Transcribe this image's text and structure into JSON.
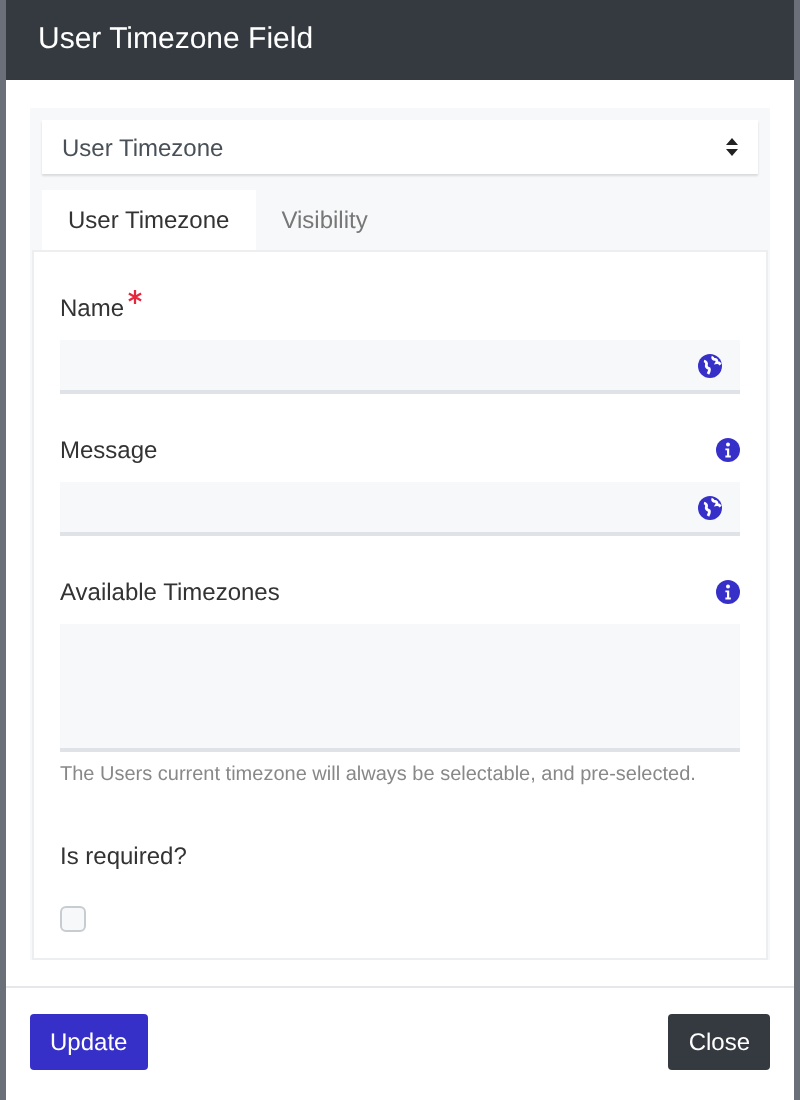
{
  "window": {
    "title": "User Timezone Field"
  },
  "type_select": {
    "value": "User Timezone"
  },
  "tabs": [
    {
      "label": "User Timezone",
      "selected": true
    },
    {
      "label": "Visibility",
      "selected": false
    }
  ],
  "fields": [
    {
      "kind": "text",
      "label": "Name",
      "required": true,
      "info": false,
      "translatable": true
    },
    {
      "kind": "text",
      "label": "Message",
      "required": false,
      "info": true,
      "translatable": true
    },
    {
      "kind": "textarea",
      "label": "Available Timezones",
      "required": false,
      "info": true,
      "help": "The Users current timezone will always be selectable, and pre-selected."
    },
    {
      "kind": "checkbox",
      "label": "Is required?",
      "checked": false
    }
  ],
  "buttons": [
    {
      "label": "Update",
      "kind": "primary"
    },
    {
      "label": "Close",
      "kind": "secondary"
    }
  ]
}
